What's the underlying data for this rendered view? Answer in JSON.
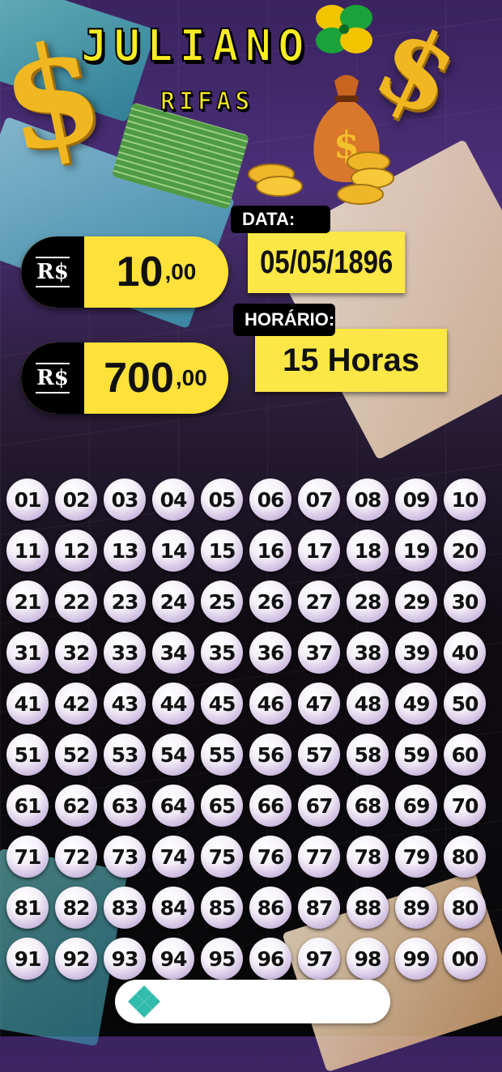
{
  "header": {
    "title": "JULIANO",
    "subtitle": "RIFAS"
  },
  "prices": [
    {
      "currency": "R$",
      "amount": "10",
      "cents": ",00"
    },
    {
      "currency": "R$",
      "amount": "700",
      "cents": ",00"
    }
  ],
  "draw_info": {
    "date_label": "DATA:",
    "date_value": "05/05/1896",
    "time_label": "HORÁRIO:",
    "time_value": "15 Horas"
  },
  "numbers": [
    "01",
    "02",
    "03",
    "04",
    "05",
    "06",
    "07",
    "08",
    "09",
    "10",
    "11",
    "12",
    "13",
    "14",
    "15",
    "16",
    "17",
    "18",
    "19",
    "20",
    "21",
    "22",
    "23",
    "24",
    "25",
    "26",
    "27",
    "28",
    "29",
    "30",
    "31",
    "32",
    "33",
    "34",
    "35",
    "36",
    "37",
    "38",
    "39",
    "40",
    "41",
    "42",
    "43",
    "44",
    "45",
    "46",
    "47",
    "48",
    "49",
    "50",
    "51",
    "52",
    "53",
    "54",
    "55",
    "56",
    "57",
    "58",
    "59",
    "60",
    "61",
    "62",
    "63",
    "64",
    "65",
    "66",
    "67",
    "68",
    "69",
    "70",
    "71",
    "72",
    "73",
    "74",
    "75",
    "76",
    "77",
    "78",
    "79",
    "80",
    "81",
    "82",
    "83",
    "84",
    "85",
    "86",
    "87",
    "88",
    "89",
    "80",
    "91",
    "92",
    "93",
    "94",
    "95",
    "96",
    "97",
    "98",
    "99",
    "00"
  ],
  "icons": {
    "pix": "pix-icon",
    "clover": "four-leaf-clover-icon",
    "money_bag": "money-bag-icon"
  },
  "colors": {
    "accent_yellow": "#ffe13a",
    "pix_teal": "#32bcad"
  }
}
